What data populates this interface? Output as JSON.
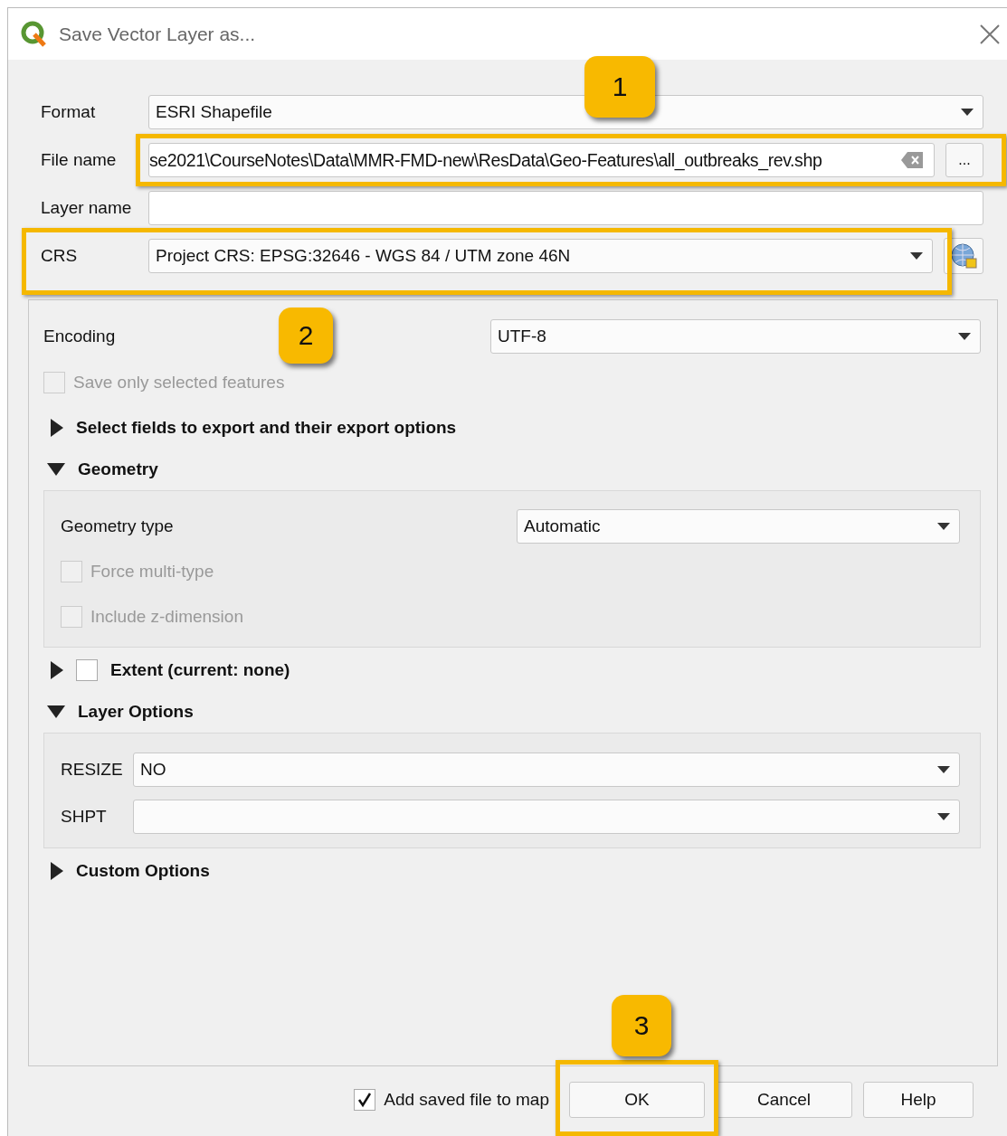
{
  "window": {
    "title": "Save Vector Layer as..."
  },
  "fields": [
    {
      "label": "Format",
      "kind": "dropdown",
      "value": "ESRI Shapefile"
    },
    {
      "label": "File name",
      "kind": "file",
      "value": "se2021\\CourseNotes\\Data\\MMR-FMD-new\\ResData\\Geo-Features\\all_outbreaks_rev.shp",
      "browse": "..."
    },
    {
      "label": "Layer name",
      "kind": "text"
    },
    {
      "label": "CRS",
      "kind": "crs",
      "value": "Project CRS: EPSG:32646 - WGS 84 / UTM zone 46N"
    }
  ],
  "encoding": {
    "label": "Encoding",
    "value": "UTF-8"
  },
  "save_only_selected": {
    "label": "Save only selected features",
    "checked": false,
    "disabled": true
  },
  "sections": [
    {
      "title": "Select fields to export and their export options",
      "expanded": false
    },
    {
      "title": "Geometry",
      "expanded": true,
      "rows": [
        {
          "kind": "dropdown",
          "label": "Geometry type",
          "value": "Automatic"
        },
        {
          "kind": "checkbox",
          "label": "Force multi-type",
          "checked": false,
          "disabled": true
        },
        {
          "kind": "checkbox",
          "label": "Include z-dimension",
          "checked": false,
          "disabled": true
        }
      ]
    },
    {
      "title": "Extent (current: none)",
      "expanded": false,
      "checked": false
    },
    {
      "title": "Layer Options",
      "expanded": true,
      "rows": [
        {
          "kind": "option",
          "label": "RESIZE",
          "value": "NO"
        },
        {
          "kind": "option",
          "label": "SHPT"
        }
      ]
    },
    {
      "title": "Custom Options",
      "expanded": false
    }
  ],
  "add_to_map": {
    "label": "Add saved file to map",
    "checked": true
  },
  "buttons": [
    "OK",
    "Cancel",
    "Help"
  ],
  "annotations": [
    {
      "label": "1"
    },
    {
      "label": "2"
    },
    {
      "label": "3"
    }
  ]
}
